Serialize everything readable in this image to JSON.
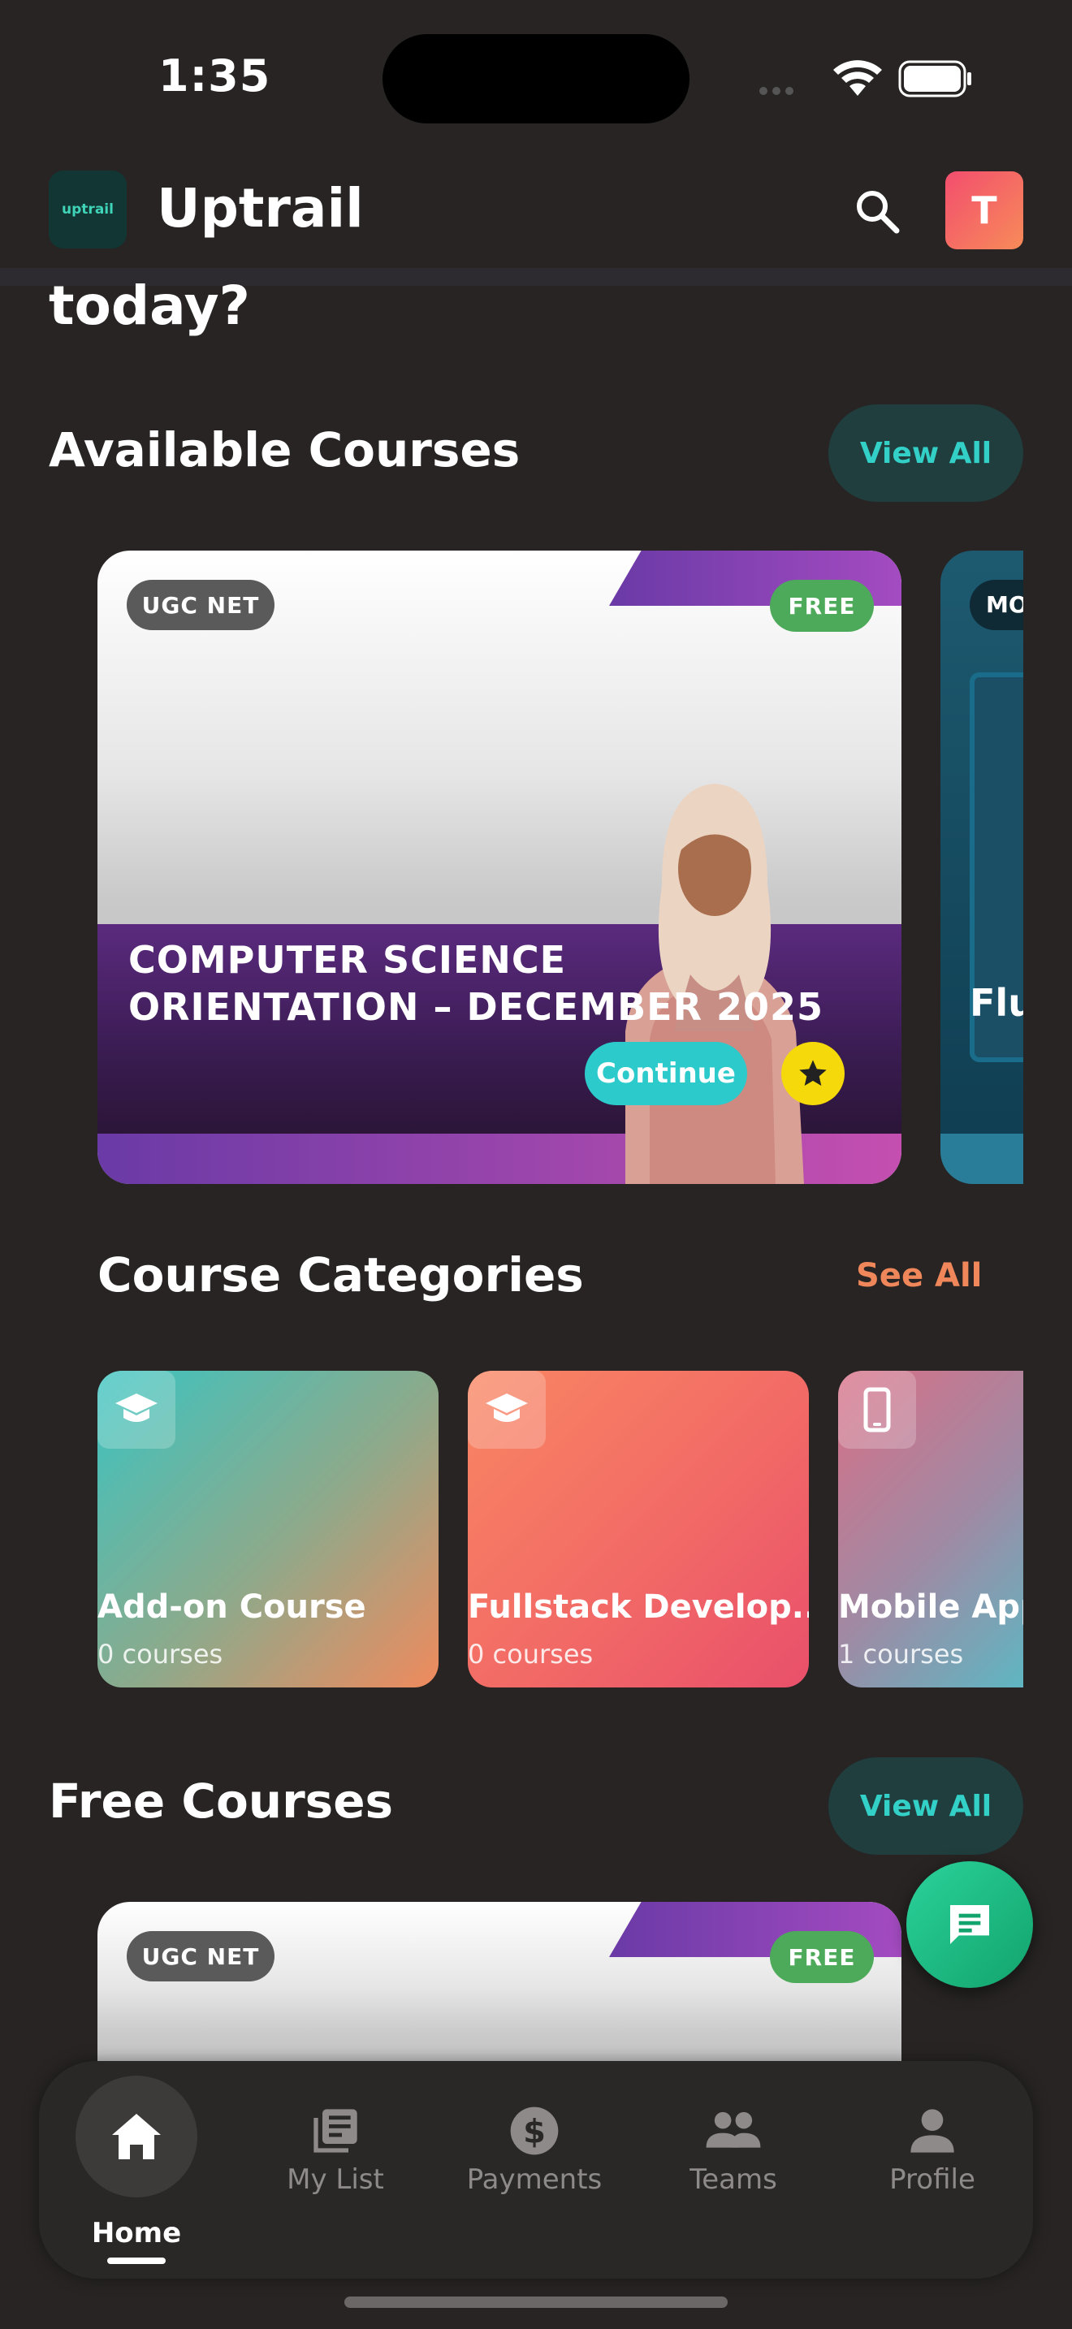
{
  "status_bar": {
    "time": "1:35"
  },
  "header": {
    "logo_text": "uptrail",
    "title": "Uptrail",
    "avatar_initial": "T"
  },
  "greeting_tail": "today?",
  "available_courses": {
    "title": "Available Courses",
    "view_all": "View All",
    "cards": [
      {
        "tag": "UGC NET",
        "badge": "FREE",
        "title": "COMPUTER SCIENCE ORIENTATION – DECEMBER 2025",
        "action": "Continue"
      },
      {
        "tag": "MO",
        "title": "Flu"
      }
    ]
  },
  "course_categories": {
    "title": "Course Categories",
    "see_all": "See All",
    "items": [
      {
        "name": "Add-on Course",
        "count": "0 courses",
        "icon": "graduation-cap-icon"
      },
      {
        "name": "Fullstack Develop...",
        "count": "0 courses",
        "icon": "graduation-cap-icon"
      },
      {
        "name": "Mobile App",
        "count": "1 courses",
        "icon": "phone-icon"
      }
    ]
  },
  "free_courses": {
    "title": "Free Courses",
    "view_all": "View All",
    "cards": [
      {
        "tag": "UGC NET",
        "badge": "FREE"
      }
    ]
  },
  "bottom_nav": {
    "items": [
      {
        "label": "Home",
        "icon": "home-icon",
        "active": true
      },
      {
        "label": "My List",
        "icon": "list-icon"
      },
      {
        "label": "Payments",
        "icon": "dollar-icon"
      },
      {
        "label": "Teams",
        "icon": "people-icon"
      },
      {
        "label": "Profile",
        "icon": "person-icon"
      }
    ]
  },
  "colors": {
    "accent": "#33d0c8",
    "see_all": "#f0875a",
    "background": "#272423"
  }
}
